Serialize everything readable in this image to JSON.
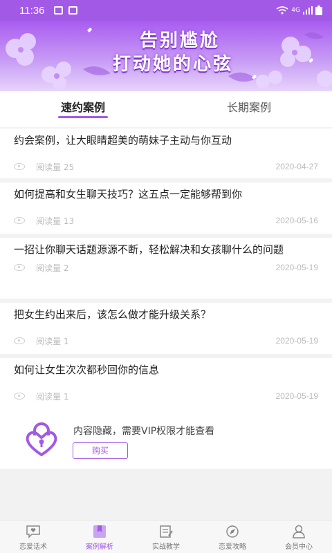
{
  "status": {
    "time": "11:36",
    "network": "4G"
  },
  "banner": {
    "line1": "告别尴尬",
    "line2": "打动她的心弦"
  },
  "tabs": [
    {
      "label": "速约案例",
      "active": true
    },
    {
      "label": "长期案例",
      "active": false
    }
  ],
  "articles": [
    {
      "title": "约会案例，让大眼睛超美的萌妹子主动与你互动",
      "reads": "阅读量 25",
      "date": "2020-04-27"
    },
    {
      "title": "如何提高和女生聊天技巧？这五点一定能够帮到你",
      "reads": "阅读量 13",
      "date": "2020-05-16"
    },
    {
      "title": "一招让你聊天话题源源不断，轻松解决和女孩聊什么的问题",
      "reads": "阅读量 2",
      "date": "2020-05-19"
    },
    {
      "title": "把女生约出来后，该怎么做才能升级关系？",
      "reads": "阅读量 1",
      "date": "2020-05-19"
    },
    {
      "title": "如何让女生次次都秒回你的信息",
      "reads": "阅读量 1",
      "date": "2020-05-19"
    }
  ],
  "vip": {
    "message": "内容隐藏，需要VIP权限才能查看",
    "button": "购买"
  },
  "nav": [
    {
      "label": "恋爱话术",
      "icon": "chat-heart-icon",
      "active": false
    },
    {
      "label": "案例解析",
      "icon": "bookmark-icon",
      "active": true
    },
    {
      "label": "实战教学",
      "icon": "notebook-icon",
      "active": false
    },
    {
      "label": "恋爱攻略",
      "icon": "compass-icon",
      "active": false
    },
    {
      "label": "会员中心",
      "icon": "user-icon",
      "active": false
    }
  ],
  "colors": {
    "accent": "#a259e6"
  }
}
